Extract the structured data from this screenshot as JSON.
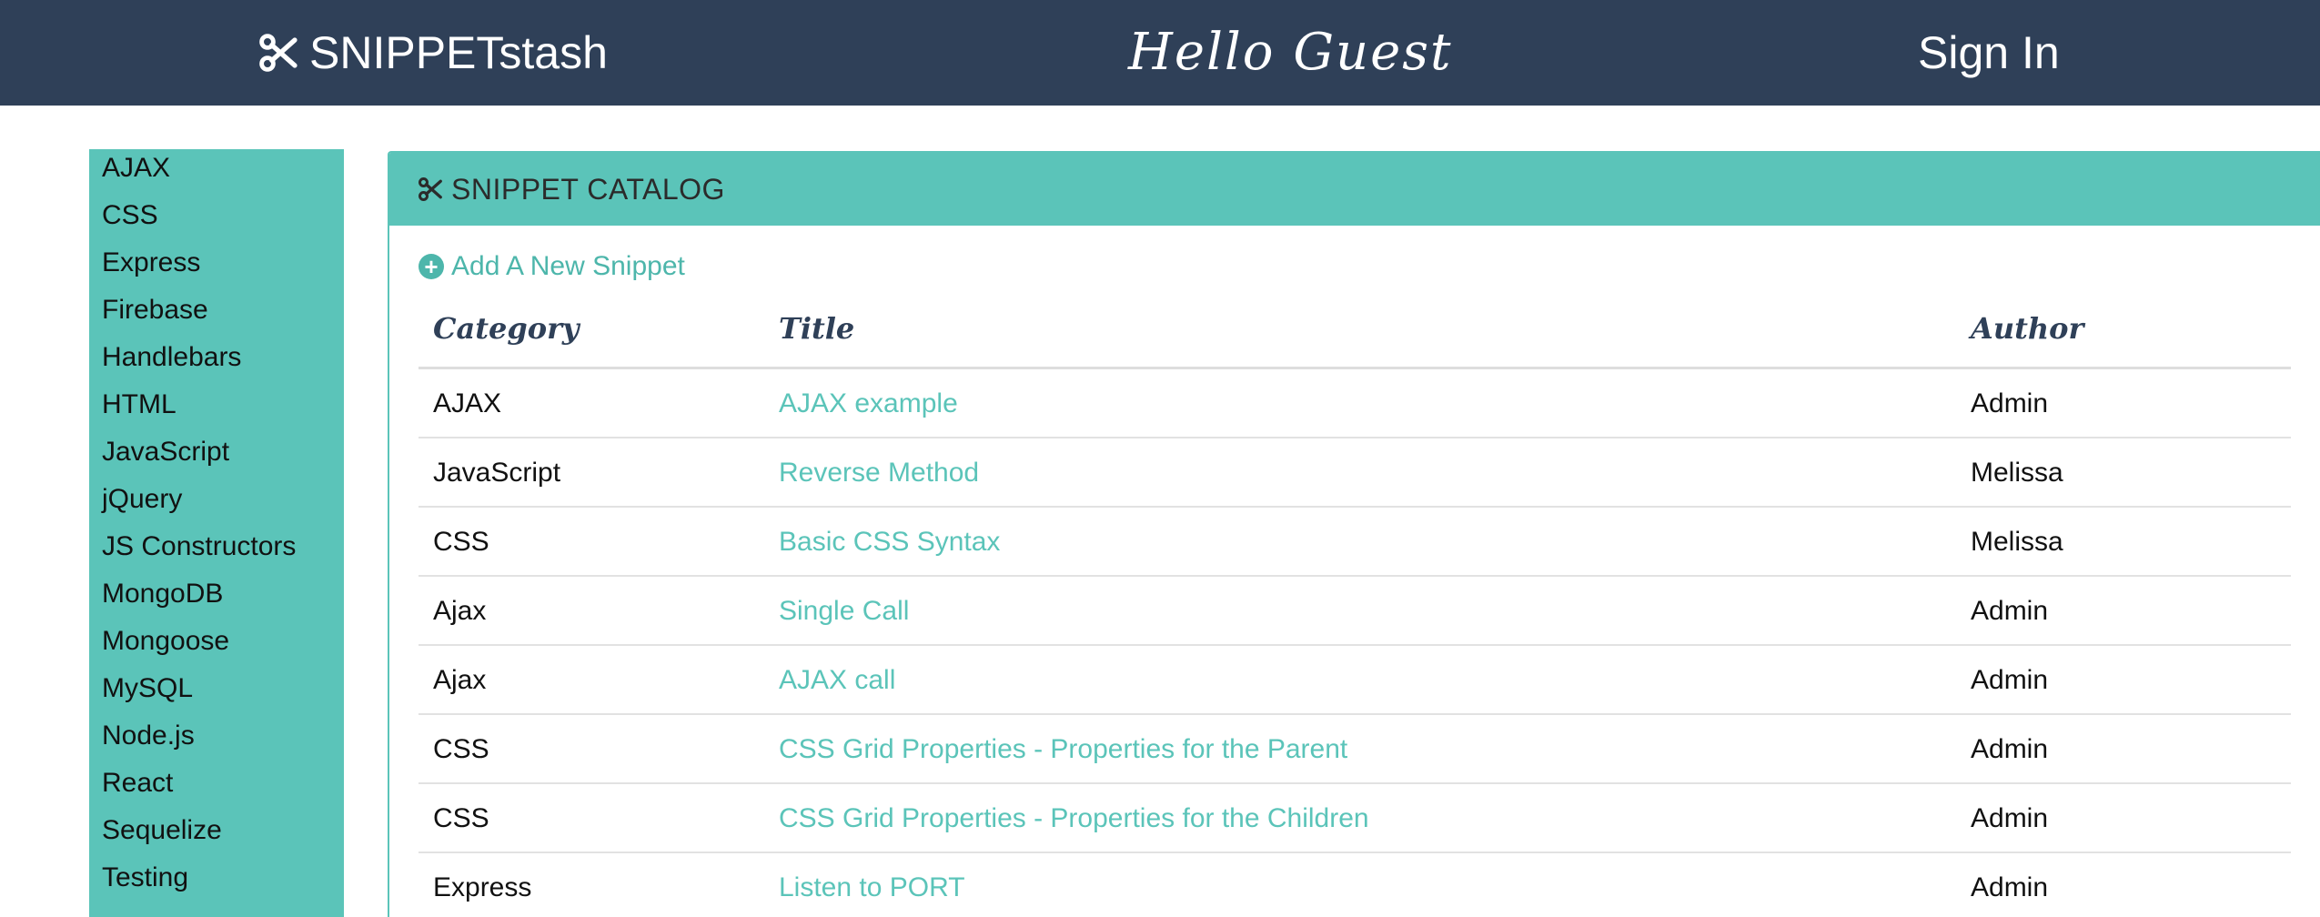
{
  "header": {
    "brand": "SNIPPETstash",
    "greeting": "Hello Guest",
    "sign_in": "Sign In"
  },
  "sidebar": {
    "items": [
      {
        "label": "AJAX"
      },
      {
        "label": "CSS"
      },
      {
        "label": "Express"
      },
      {
        "label": "Firebase"
      },
      {
        "label": "Handlebars"
      },
      {
        "label": "HTML"
      },
      {
        "label": "JavaScript"
      },
      {
        "label": "jQuery"
      },
      {
        "label": "JS Constructors"
      },
      {
        "label": "MongoDB"
      },
      {
        "label": "Mongoose"
      },
      {
        "label": "MySQL"
      },
      {
        "label": "Node.js"
      },
      {
        "label": "React"
      },
      {
        "label": "Sequelize"
      },
      {
        "label": "Testing"
      }
    ]
  },
  "catalog": {
    "heading": "SNIPPET CATALOG",
    "add_link": "Add A New Snippet",
    "columns": {
      "category": "Category",
      "title": "Title",
      "author": "Author"
    },
    "rows": [
      {
        "category": "AJAX",
        "title": "AJAX example",
        "author": "Admin"
      },
      {
        "category": "JavaScript",
        "title": "Reverse Method",
        "author": "Melissa"
      },
      {
        "category": "CSS",
        "title": "Basic CSS Syntax",
        "author": "Melissa"
      },
      {
        "category": "Ajax",
        "title": "Single Call",
        "author": "Admin"
      },
      {
        "category": "Ajax",
        "title": "AJAX call",
        "author": "Admin"
      },
      {
        "category": "CSS",
        "title": "CSS Grid Properties - Properties for the Parent",
        "author": "Admin"
      },
      {
        "category": "CSS",
        "title": "CSS Grid Properties - Properties for the Children",
        "author": "Admin"
      },
      {
        "category": "Express",
        "title": "Listen to PORT",
        "author": "Admin"
      }
    ]
  },
  "colors": {
    "header_bg": "#2f4058",
    "accent": "#5bc4b9",
    "link": "#5bc4b9"
  },
  "icons": {
    "brand": "scissors-icon",
    "panel": "scissors-icon",
    "add": "plus-circle-icon"
  }
}
